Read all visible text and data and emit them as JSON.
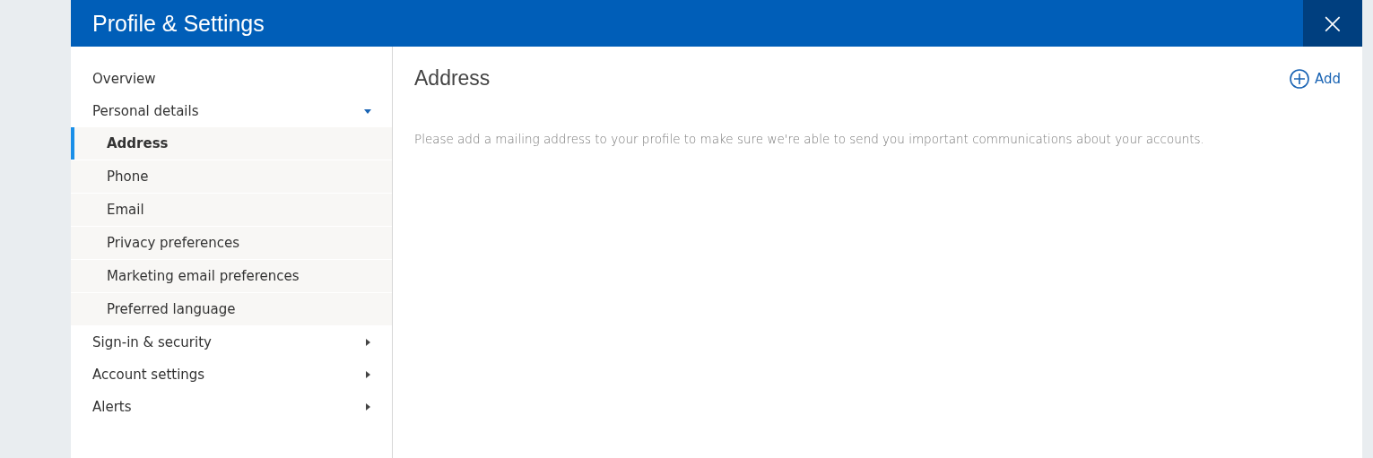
{
  "window": {
    "title": "Profile & Settings",
    "close_label": "×"
  },
  "sidebar": {
    "items": [
      {
        "kind": "link",
        "label": "Overview"
      },
      {
        "kind": "group",
        "label": "Personal details",
        "expanded": true,
        "children": [
          {
            "label": "Address",
            "selected": true
          },
          {
            "label": "Phone",
            "selected": false
          },
          {
            "label": "Email",
            "selected": false
          },
          {
            "label": "Privacy preferences",
            "selected": false
          },
          {
            "label": "Marketing email preferences",
            "selected": false
          },
          {
            "label": "Preferred language",
            "selected": false
          }
        ]
      },
      {
        "kind": "group",
        "label": "Sign-in & security",
        "expanded": false
      },
      {
        "kind": "group",
        "label": "Account settings",
        "expanded": false
      },
      {
        "kind": "group",
        "label": "Alerts",
        "expanded": false
      }
    ]
  },
  "content": {
    "heading": "Address",
    "add_button": "Add",
    "message": "Please add a mailing address to your profile to make sure we're able to send you important communications about your accounts."
  }
}
